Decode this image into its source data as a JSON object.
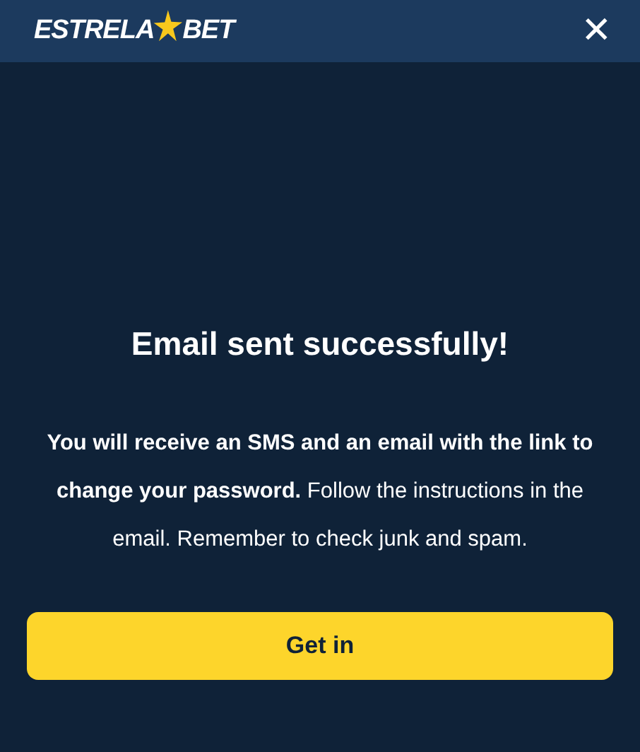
{
  "header": {
    "logo": {
      "left": "ESTRELA",
      "right": "BET"
    },
    "close": "✕"
  },
  "title": "Email sent successfully!",
  "message": "**You will receive an SMS and an email with the link to change your password.** Follow the instructions in the email. Remember to check junk and spam.",
  "button": "Get in"
}
